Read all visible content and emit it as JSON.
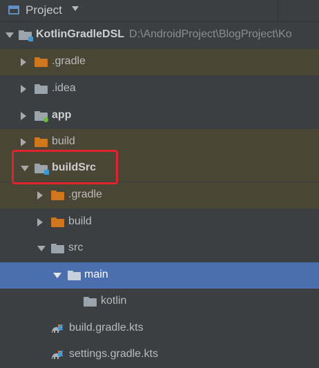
{
  "header": {
    "title": "Project",
    "icon": "project-window-icon",
    "dropdown_icon": "chevron-down-icon"
  },
  "tree": {
    "root": {
      "label": "KotlinGradleDSL",
      "path": "D:\\AndroidProject\\BlogProject\\Ko"
    },
    "items": [
      {
        "label": ".gradle"
      },
      {
        "label": ".idea"
      },
      {
        "label": "app"
      },
      {
        "label": "build"
      },
      {
        "label": "buildSrc"
      },
      {
        "label": ".gradle"
      },
      {
        "label": "build"
      },
      {
        "label": "src"
      },
      {
        "label": "main"
      },
      {
        "label": "kotlin"
      },
      {
        "label": "build.gradle.kts"
      },
      {
        "label": "settings.gradle.kts"
      }
    ]
  },
  "colors": {
    "background": "#3c3f41",
    "excluded_row": "#4a4636",
    "selected_row": "#4b6eaf",
    "highlight_box": "#e0242b",
    "folder_gray": "#9ba3ab",
    "folder_orange": "#d0771e",
    "module_badge": "#3a9ad9"
  }
}
